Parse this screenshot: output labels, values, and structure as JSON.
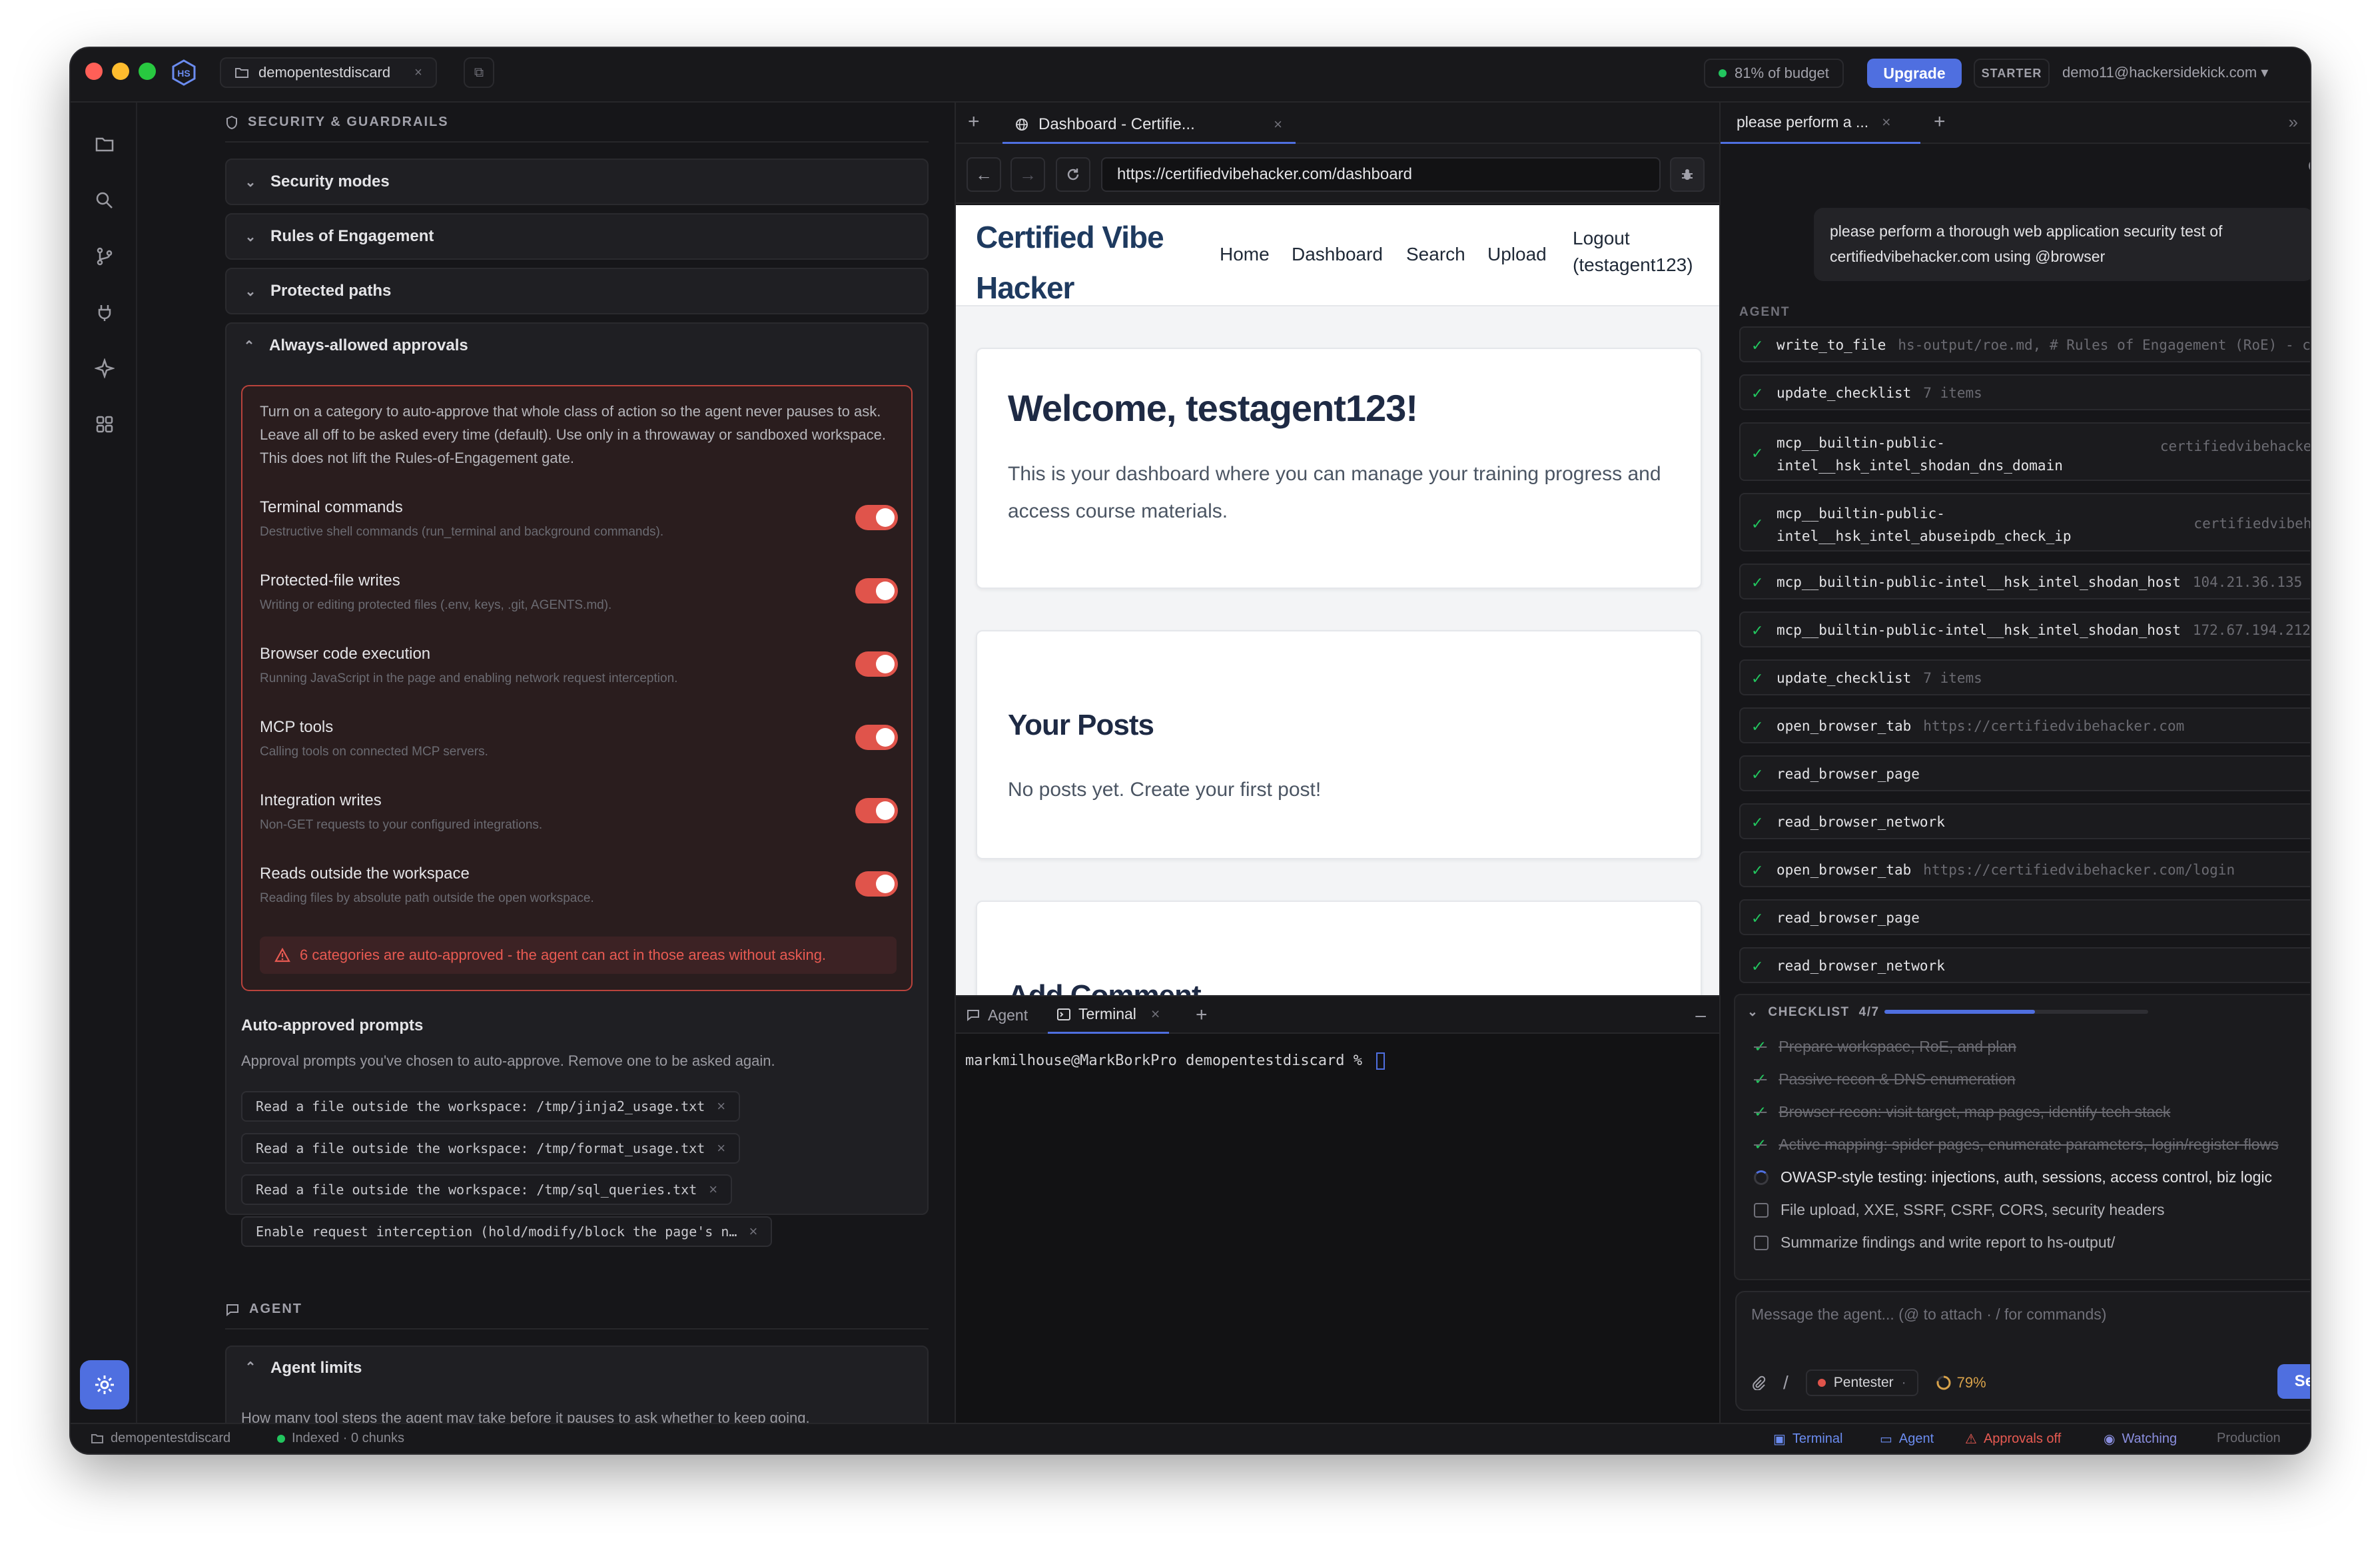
{
  "titlebar": {
    "workspace_tab": "demopentestdiscard",
    "budget": "81% of budget",
    "upgrade": "Upgrade",
    "plan": "STARTER",
    "email": "demo11@hackersidekick.com"
  },
  "rail": {
    "icons": [
      "folder-icon",
      "search-icon",
      "git-branch-icon",
      "plug-icon",
      "sparkle-icon",
      "grid-icon"
    ]
  },
  "left": {
    "section_security": "SECURITY & GUARDRAILS",
    "accordions": [
      "Security modes",
      "Rules of Engagement",
      "Protected paths",
      "Always-allowed approvals"
    ],
    "intro": "Turn on a category to auto-approve that whole class of action so the agent never pauses to ask. Leave all off to be asked every time (default). Use only in a throwaway or sandboxed workspace. This does not lift the Rules-of-Engagement gate.",
    "toggles": [
      {
        "title": "Terminal commands",
        "desc": "Destructive shell commands (run_terminal and background commands).",
        "on": true
      },
      {
        "title": "Protected-file writes",
        "desc": "Writing or editing protected files (.env, keys, .git, AGENTS.md).",
        "on": true
      },
      {
        "title": "Browser code execution",
        "desc": "Running JavaScript in the page and enabling network request interception.",
        "on": true
      },
      {
        "title": "MCP tools",
        "desc": "Calling tools on connected MCP servers.",
        "on": true
      },
      {
        "title": "Integration writes",
        "desc": "Non-GET requests to your configured integrations.",
        "on": true
      },
      {
        "title": "Reads outside the workspace",
        "desc": "Reading files by absolute path outside the open workspace.",
        "on": true
      }
    ],
    "warning": "6 categories are auto-approved - the agent can act in those areas without asking.",
    "auto_title": "Auto-approved prompts",
    "auto_desc": "Approval prompts you've chosen to auto-approve. Remove one to be asked again.",
    "prompts": [
      "Read a file outside the workspace: /tmp/jinja2_usage.txt",
      "Read a file outside the workspace: /tmp/format_usage.txt",
      "Read a file outside the workspace: /tmp/sql_queries.txt",
      "Enable request interception (hold/modify/block the page's n…"
    ],
    "section_agent": "AGENT",
    "agent_limits": "Agent limits",
    "agent_limits_desc": "How many tool steps the agent may take before it pauses to ask whether to keep going."
  },
  "browser": {
    "tab_title": "Dashboard - Certifie...",
    "url": "https://certifiedvibehacker.com/dashboard",
    "site": {
      "logo_line1": "Certified Vibe",
      "logo_line2": "Hacker",
      "nav": [
        "Home",
        "Dashboard",
        "Search",
        "Upload"
      ],
      "logout_line1": "Logout",
      "logout_line2": "(testagent123)",
      "welcome": "Welcome, testagent123!",
      "welcome_text": "This is your dashboard where you can manage your training progress and access course materials.",
      "posts_title": "Your Posts",
      "posts_text": "No posts yet. Create your first post!",
      "comment_title": "Add Comment"
    }
  },
  "terminal": {
    "tab_agent": "Agent",
    "tab_terminal": "Terminal",
    "prompt": "markmilhouse@MarkBorkPro demopentestdiscard % "
  },
  "right": {
    "tab_title": "please perform a ...",
    "user_message": "please perform a thorough web application security test of certifiedvibehacker.com using @browser",
    "agent_label": "AGENT",
    "tools": [
      {
        "name": "write_to_file",
        "arg": "hs-output/roe.md, # Rules of Engagement (RoE) - cer…"
      },
      {
        "name": "update_checklist",
        "arg": "7 items"
      },
      {
        "name": "mcp__builtin-public-",
        "name2": "intel__hsk_intel_shodan_dns_domain",
        "argr": "certifiedvibehacker.c…"
      },
      {
        "name": "mcp__builtin-public-",
        "name2": "intel__hsk_intel_abuseipdb_check_ip",
        "argr": "certifiedvibehack…"
      },
      {
        "name": "mcp__builtin-public-intel__hsk_intel_shodan_host",
        "arg": "104.21.36.135"
      },
      {
        "name": "mcp__builtin-public-intel__hsk_intel_shodan_host",
        "arg": "172.67.194.212"
      },
      {
        "name": "update_checklist",
        "arg": "7 items"
      },
      {
        "name": "open_browser_tab",
        "arg": "https://certifiedvibehacker.com"
      },
      {
        "name": "read_browser_page",
        "arg": ""
      },
      {
        "name": "read_browser_network",
        "arg": ""
      },
      {
        "name": "open_browser_tab",
        "arg": "https://certifiedvibehacker.com/login"
      },
      {
        "name": "read_browser_page",
        "arg": ""
      },
      {
        "name": "read_browser_network",
        "arg": ""
      }
    ],
    "checklist_label": "CHECKLIST",
    "checklist_count": "4/7",
    "checklist_progress": 0.57,
    "checklist": [
      {
        "text": "Prepare workspace, RoE, and plan",
        "state": "done"
      },
      {
        "text": "Passive recon & DNS enumeration",
        "state": "done"
      },
      {
        "text": "Browser recon: visit target, map pages, identify tech stack",
        "state": "done"
      },
      {
        "text": "Active mapping: spider pages, enumerate parameters, login/register flows",
        "state": "done"
      },
      {
        "text": "OWASP-style testing: injections, auth, sessions, access control, biz logic",
        "state": "active"
      },
      {
        "text": "File upload, XXE, SSRF, CSRF, CORS, security headers",
        "state": "todo"
      },
      {
        "text": "Summarize findings and write report to hs-output/",
        "state": "todo"
      }
    ],
    "composer_placeholder": "Message the agent...  (@ to attach · / for commands)",
    "mode": "Pentester",
    "context": "79%",
    "send": "Send"
  },
  "status": {
    "workspace": "demopentestdiscard",
    "index": "Indexed · 0 chunks",
    "terminal": "Terminal",
    "agent": "Agent",
    "approvals": "Approvals off",
    "watching": "Watching",
    "env": "Production"
  },
  "colors": {
    "accent": "#4f6fe0",
    "danger": "#e0544b",
    "success": "#22c55e"
  }
}
